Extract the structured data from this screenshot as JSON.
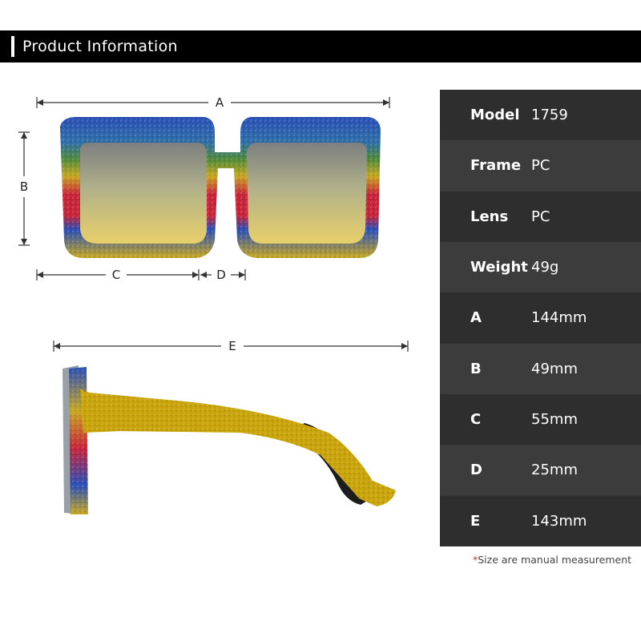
{
  "header": {
    "title": "Product Information"
  },
  "diagram": {
    "labels": {
      "A": "A",
      "B": "B",
      "C": "C",
      "D": "D",
      "E": "E"
    },
    "frame_stripe_colors": [
      "#2a4fb8",
      "#3a8a3a",
      "#c8a820",
      "#c8243a",
      "#2a4fb8",
      "#c8a820"
    ],
    "lens_colors": [
      "#7c7f7e",
      "#b0b08a",
      "#e8d06a"
    ],
    "temple_color": "#c9a40a",
    "temple_inner_color": "#1c1c1c"
  },
  "specs": [
    {
      "key": "Model",
      "value": "1759"
    },
    {
      "key": "Frame",
      "value": "PC"
    },
    {
      "key": "Lens",
      "value": "PC"
    },
    {
      "key": "Weight",
      "value": "49g"
    },
    {
      "key": "A",
      "value": "144mm"
    },
    {
      "key": "B",
      "value": "49mm"
    },
    {
      "key": "C",
      "value": "55mm"
    },
    {
      "key": "D",
      "value": "25mm"
    },
    {
      "key": "E",
      "value": "143mm"
    }
  ],
  "footnote": {
    "star": "*",
    "text": "Size are manual measurement"
  },
  "colors": {
    "header_bg": "#000000",
    "table_dark": "#2e2e2e",
    "table_light": "#3c3c3c",
    "footnote_star": "#c0392b"
  }
}
